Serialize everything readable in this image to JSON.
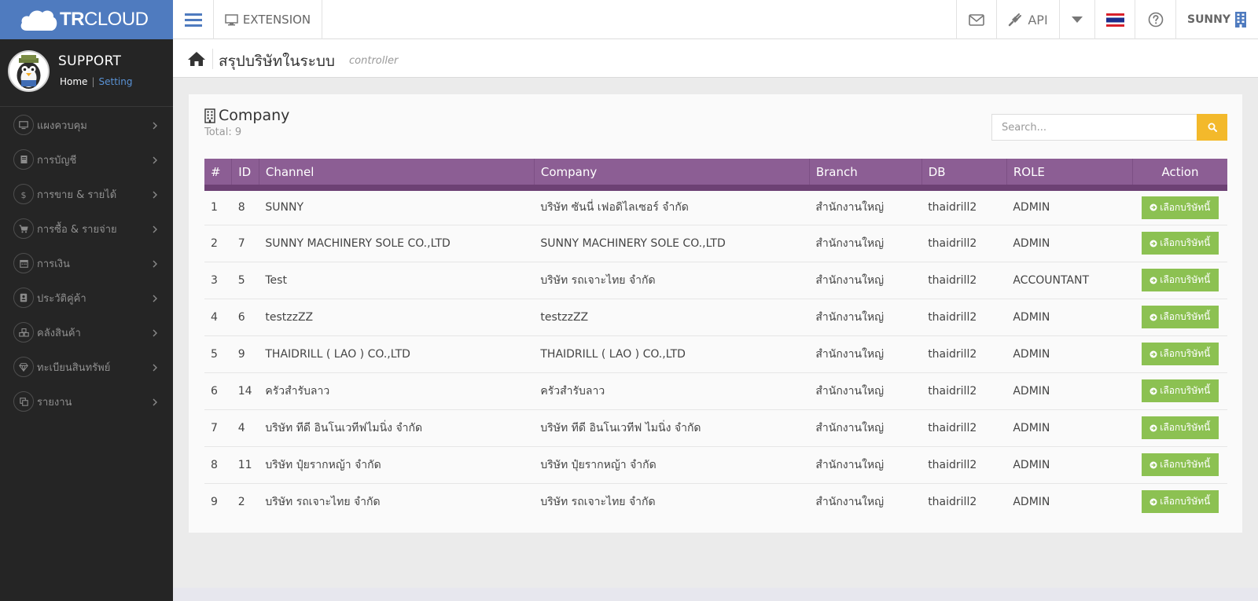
{
  "brand": {
    "tr": "TR",
    "cloud": "CLOUD"
  },
  "topbar": {
    "extension_label": "EXTENSION",
    "api_label": "API",
    "user_label": "SUNNY"
  },
  "sidebar": {
    "profile_name": "SUPPORT",
    "home_link": "Home",
    "separator": "|",
    "setting_link": "Setting",
    "items": [
      {
        "label": "แผงควบคุม",
        "icon": "monitor-icon"
      },
      {
        "label": "การบัญชี",
        "icon": "book-icon"
      },
      {
        "label": "การขาย & รายได้",
        "icon": "dollar-icon"
      },
      {
        "label": "การซื้อ & รายจ่าย",
        "icon": "cart-icon"
      },
      {
        "label": "การเงิน",
        "icon": "calendar-icon"
      },
      {
        "label": "ประวัติคู่ค้า",
        "icon": "contact-icon"
      },
      {
        "label": "คลังสินค้า",
        "icon": "cubes-icon"
      },
      {
        "label": "ทะเบียนสินทรัพย์",
        "icon": "diamond-icon"
      },
      {
        "label": "รายงาน",
        "icon": "copy-icon"
      }
    ]
  },
  "breadcrumb": {
    "title": "สรุปบริษัทในระบบ",
    "sub": "controller"
  },
  "panel": {
    "title": "Company",
    "total_label": "Total:",
    "total_value": "9",
    "search_placeholder": "Search..."
  },
  "table": {
    "headers": [
      "#",
      "ID",
      "Channel",
      "Company",
      "Branch",
      "DB",
      "ROLE",
      "Action"
    ],
    "action_label": "เลือกบริษัทนี้",
    "rows": [
      {
        "no": "1",
        "id": "8",
        "channel": "SUNNY",
        "company": "บริษัท ซันนี่ เฟอดิไลเซอร์ จำกัด",
        "branch": "สำนักงานใหญ่",
        "db": "thaidrill2",
        "role": "ADMIN"
      },
      {
        "no": "2",
        "id": "7",
        "channel": "SUNNY MACHINERY SOLE CO.,LTD",
        "company": "SUNNY MACHINERY SOLE CO.,LTD",
        "branch": "สำนักงานใหญ่",
        "db": "thaidrill2",
        "role": "ADMIN"
      },
      {
        "no": "3",
        "id": "5",
        "channel": "Test",
        "company": "บริษัท รถเจาะไทย จำกัด",
        "branch": "สำนักงานใหญ่",
        "db": "thaidrill2",
        "role": "ACCOUNTANT"
      },
      {
        "no": "4",
        "id": "6",
        "channel": "testzzZZ",
        "company": "testzzZZ",
        "branch": "สำนักงานใหญ่",
        "db": "thaidrill2",
        "role": "ADMIN"
      },
      {
        "no": "5",
        "id": "9",
        "channel": "THAIDRILL ( LAO ) CO.,LTD",
        "company": "THAIDRILL ( LAO ) CO.,LTD",
        "branch": "สำนักงานใหญ่",
        "db": "thaidrill2",
        "role": "ADMIN"
      },
      {
        "no": "6",
        "id": "14",
        "channel": "ครัวสำรับลาว",
        "company": "ครัวสำรับลาว",
        "branch": "สำนักงานใหญ่",
        "db": "thaidrill2",
        "role": "ADMIN"
      },
      {
        "no": "7",
        "id": "4",
        "channel": "บริษัท ทีดี อินโนเวทีฟไมนิ่ง จำกัด",
        "company": "บริษัท ทีดี อินโนเวทีฟ ไมนิ่ง จำกัด",
        "branch": "สำนักงานใหญ่",
        "db": "thaidrill2",
        "role": "ADMIN"
      },
      {
        "no": "8",
        "id": "11",
        "channel": "บริษัท ปุ๋ยรากหญ้า จำกัด",
        "company": "บริษัท ปุ๋ยรากหญ้า จำกัด",
        "branch": "สำนักงานใหญ่",
        "db": "thaidrill2",
        "role": "ADMIN"
      },
      {
        "no": "9",
        "id": "2",
        "channel": "บริษัท รถเจาะไทย จำกัด",
        "company": "บริษัท รถเจาะไทย จำกัด",
        "branch": "สำนักงานใหญ่",
        "db": "thaidrill2",
        "role": "ADMIN"
      }
    ]
  },
  "colors": {
    "brand_blue": "#4f7bbf",
    "sidebar_bg": "#252525",
    "table_header": "#8c5e94",
    "action_green": "#8cc152",
    "search_yellow": "#f3b92b"
  }
}
